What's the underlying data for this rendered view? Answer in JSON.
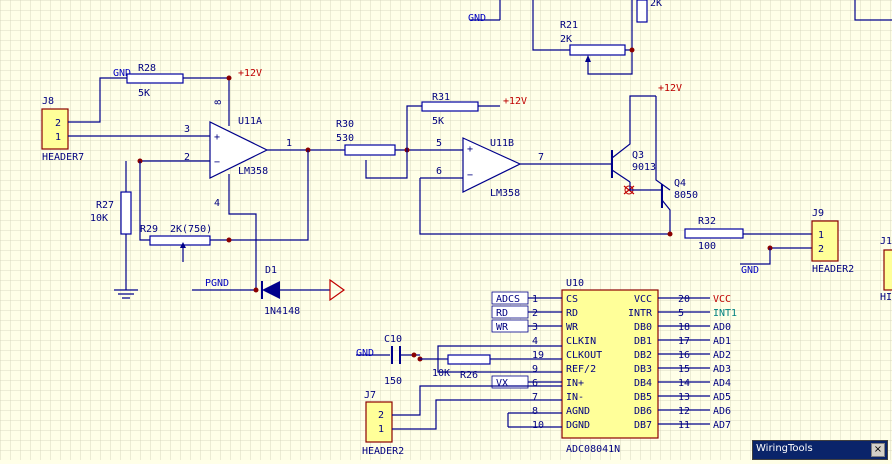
{
  "labels": {
    "gnd": "GND",
    "pgnd": "PGND",
    "vcc12": "+12V",
    "vcc": "VCC",
    "int1": "INT1",
    "vx": "VX"
  },
  "refs": {
    "j8": "J8",
    "j8_name": "HEADER7",
    "j8_p2": "2",
    "j8_p1": "1",
    "r28": "R28",
    "r28_val": "5K",
    "r27": "R27",
    "r27_val": "10K",
    "r29": "R29",
    "r29_val": "2K(750)",
    "u11a": "U11A",
    "u11a_part": "LM358",
    "u11a_p3": "3",
    "u11a_p2": "2",
    "u11a_p1": "1",
    "u11a_p8": "8",
    "u11a_p4": "4",
    "r30": "R30",
    "r30_val": "530",
    "r31": "R31",
    "r31_val": "5K",
    "r21": "R21",
    "r21_val": "2K",
    "r2k_top": "2K",
    "u11b": "U11B",
    "u11b_part": "LM358",
    "u11b_p5": "5",
    "u11b_p6": "6",
    "u11b_p7": "7",
    "q3": "Q3",
    "q3_part": "9013",
    "q4": "Q4",
    "q4_part": "8050",
    "r32": "R32",
    "r32_val": "100",
    "j9": "J9",
    "j9_name": "HEADER2",
    "j9_p1": "1",
    "j9_p2": "2",
    "j1_partial": "J1",
    "j1_name_partial": "HI",
    "d1": "D1",
    "d1_part": "1N4148",
    "c10": "C10",
    "c10_val": "150",
    "r26": "R26",
    "r26_val": "10K",
    "j7": "J7",
    "j7_name": "HEADER2",
    "j7_p2": "2",
    "j7_p1": "1",
    "u10": "U10",
    "u10_part": "ADC08041N"
  },
  "adc_left": [
    {
      "net": "ADCS",
      "pin": "1",
      "name": "CS"
    },
    {
      "net": "RD",
      "pin": "2",
      "name": "RD"
    },
    {
      "net": "WR",
      "pin": "3",
      "name": "WR"
    },
    {
      "net": "",
      "pin": "4",
      "name": "CLKIN"
    },
    {
      "net": "",
      "pin": "19",
      "name": "CLKOUT"
    },
    {
      "net": "",
      "pin": "9",
      "name": "REF/2"
    },
    {
      "net": "VX",
      "pin": "6",
      "name": "IN+"
    },
    {
      "net": "",
      "pin": "7",
      "name": "IN-"
    },
    {
      "net": "",
      "pin": "8",
      "name": "AGND"
    },
    {
      "net": "",
      "pin": "10",
      "name": "DGND"
    }
  ],
  "adc_right": [
    {
      "name": "VCC",
      "pin": "20",
      "net": "VCC"
    },
    {
      "name": "INTR",
      "pin": "5",
      "net": "INT1"
    },
    {
      "name": "DB0",
      "pin": "18",
      "net": "AD0"
    },
    {
      "name": "DB1",
      "pin": "17",
      "net": "AD1"
    },
    {
      "name": "DB2",
      "pin": "16",
      "net": "AD2"
    },
    {
      "name": "DB3",
      "pin": "15",
      "net": "AD3"
    },
    {
      "name": "DB4",
      "pin": "14",
      "net": "AD4"
    },
    {
      "name": "DB5",
      "pin": "13",
      "net": "AD5"
    },
    {
      "name": "DB6",
      "pin": "12",
      "net": "AD6"
    },
    {
      "name": "DB7",
      "pin": "11",
      "net": "AD7"
    }
  ],
  "toolbar": {
    "title": "WiringTools",
    "close": "×"
  },
  "colors": {
    "sheet": "#ffffe8",
    "grid": "#c8c8b4",
    "wire": "#00008b",
    "component": "#8b0000",
    "label_red": "#c00000",
    "label_teal": "#008080"
  }
}
